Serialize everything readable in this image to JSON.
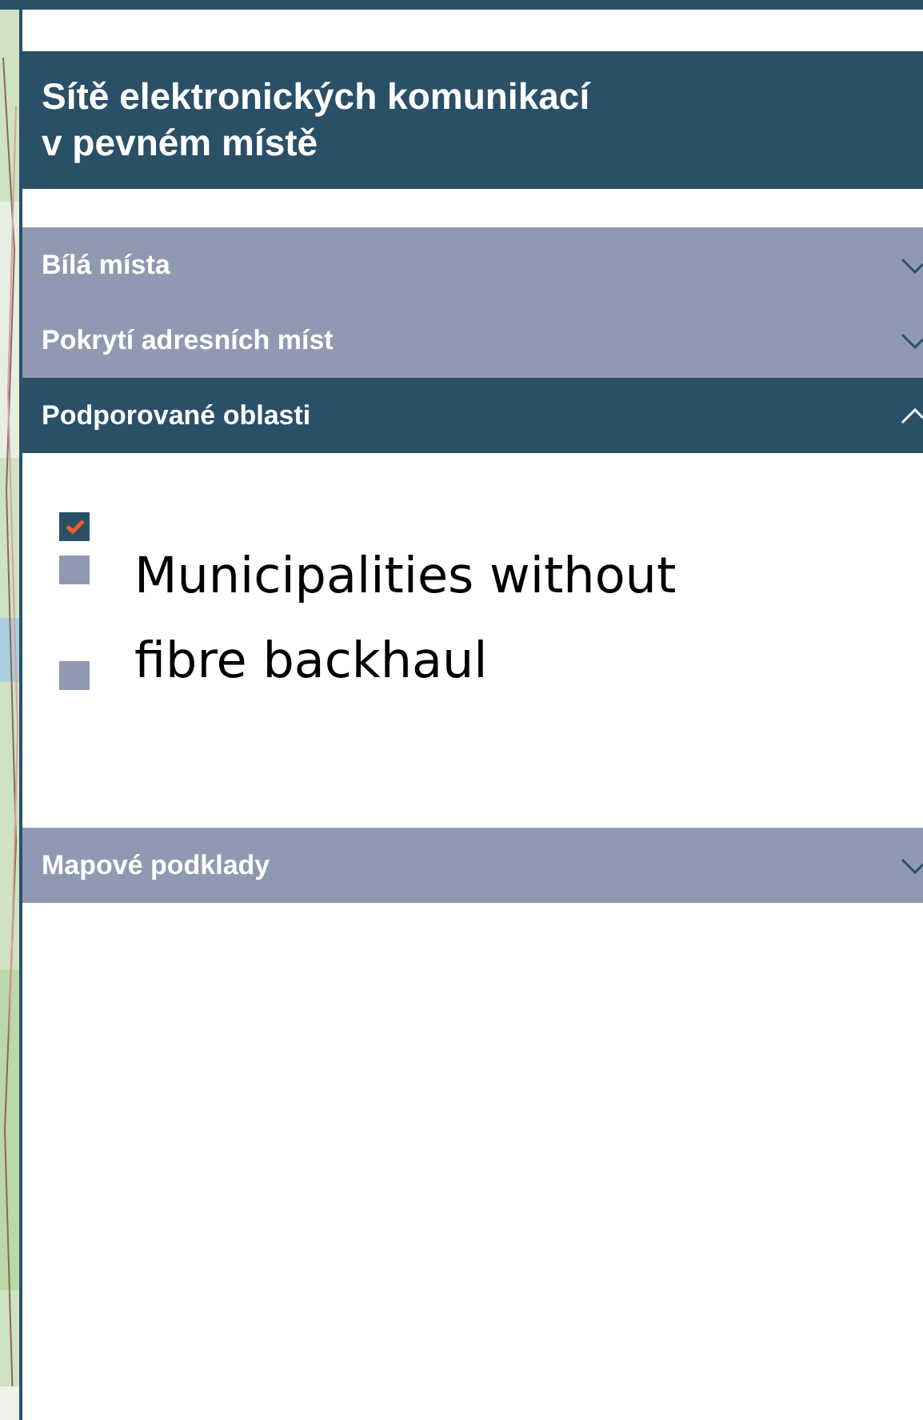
{
  "panel": {
    "title_lines": [
      "Sítě elektronických komunikací",
      "v pevném místě"
    ]
  },
  "sections": [
    {
      "label": "Bílá místa",
      "expanded": false
    },
    {
      "label": "Pokrytí adresních míst",
      "expanded": false
    },
    {
      "label": "Podporované oblasti",
      "expanded": true,
      "layers": [
        {
          "kind": "checkbox",
          "checked": true
        },
        {
          "kind": "swatch"
        },
        {
          "kind": "swatch"
        }
      ],
      "legend_label": "Municipalities without fibre backhaul"
    },
    {
      "label": "Mapové podklady",
      "expanded": false
    }
  ]
}
